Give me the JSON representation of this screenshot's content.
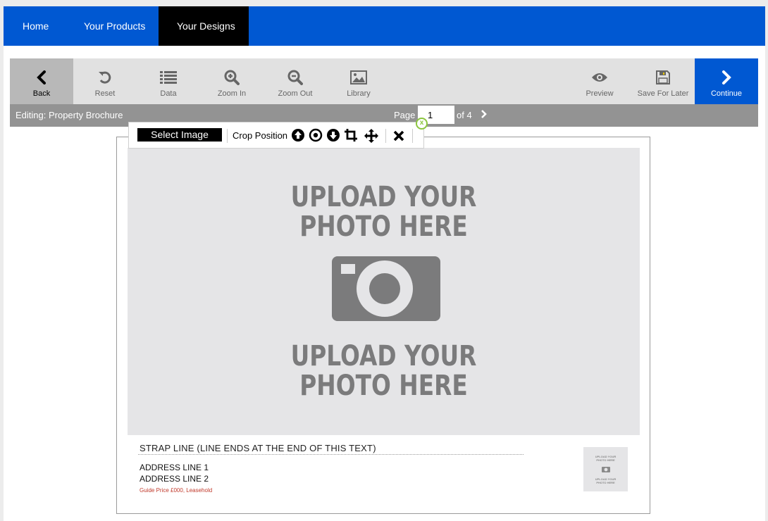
{
  "topnav": {
    "items": [
      {
        "label": "Home"
      },
      {
        "label": "Your Products"
      },
      {
        "label": "Your Designs",
        "active": true
      }
    ]
  },
  "toolbar": {
    "back_label": "Back",
    "reset_label": "Reset",
    "data_label": "Data",
    "zoom_in_label": "Zoom In",
    "zoom_out_label": "Zoom Out",
    "library_label": "Library",
    "preview_label": "Preview",
    "save_label": "Save For Later",
    "continue_label": "Continue"
  },
  "status": {
    "editing": "Editing: Property Brochure",
    "page_label": "Page",
    "page_value": "1",
    "of_label": "of 4",
    "close_glyph": "x"
  },
  "image_toolbar": {
    "select_label": "Select Image",
    "crop_label": "Crop Position"
  },
  "canvas": {
    "photo_headline_top_1": "UPLOAD YOUR",
    "photo_headline_top_2": "PHOTO HERE",
    "photo_headline_bottom_1": "UPLOAD YOUR",
    "photo_headline_bottom_2": "PHOTO HERE",
    "strap_line": "STRAP LINE (LINE ENDS AT THE END OF THIS TEXT)",
    "address_line_1": "ADDRESS LINE 1",
    "address_line_2": "ADDRESS LINE 2",
    "guide_price": "Guide Price £000, Leasehold",
    "thumb_text_1": "UPLOAD YOUR PHOTO HERE",
    "thumb_text_2": "UPLOAD YOUR PHOTO HERE"
  },
  "colors": {
    "brand_blue": "#0058d2",
    "toolbar_grey": "#e1e1e1",
    "status_grey": "#939393",
    "accent_green": "#8cc63f",
    "guide_red": "#c0392b"
  }
}
